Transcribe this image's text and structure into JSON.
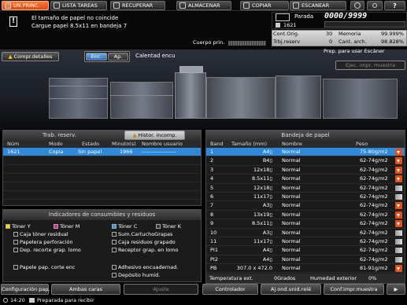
{
  "tabs": [
    {
      "label": "UN.PRINC.",
      "active": true
    },
    {
      "label": "LISTA TAREAS"
    },
    {
      "label": "RECUPERAR"
    },
    {
      "label": "ALMACENAR"
    },
    {
      "label": "COPIAR"
    },
    {
      "label": "ESCANEAR"
    }
  ],
  "message": {
    "line1": "El tamaño de papel no coincide",
    "line2": "Cargue papel 8.5x11 en bandeja 7"
  },
  "counter": {
    "state": "Parada",
    "value": "0000/9999",
    "job": "1621"
  },
  "stats": {
    "orig_label": "Cont.Orig.",
    "orig_value": "30",
    "mem_label": "Memoria",
    "mem_value": "99.999%",
    "reserv_label": "Trbj.reserv",
    "reserv_value": "0",
    "arch_label": "Cant. arch.",
    "arch_value": "98.828%"
  },
  "cuerpo_label": "Cuerpo prin.",
  "machine": {
    "details_button": "Compr.detalles",
    "enc_button": "Enc.",
    "ap_button": "Ap.",
    "heat_label": "Calentad encu",
    "scan_status": "Prep. para usar Escáner",
    "sample_button": "Ejec. impr. muestra"
  },
  "jobs": {
    "title": "Trab. reserv.",
    "history_button": "Histor. incomp.",
    "columns": [
      "Núm",
      "Modo",
      "Estado",
      "Minuto(s)",
      "Nombre usuario"
    ],
    "rows": [
      {
        "num": "1621",
        "mode": "Copia",
        "state": "Sin papel",
        "minutes": "1966",
        "user": "-------------------"
      }
    ]
  },
  "consumables": {
    "title": "Indicadores de consumibles y residuos",
    "items": [
      "Tóner Y",
      "Tóner M",
      "Tóner C",
      "Tóner K",
      "Caja tóner residual",
      "Sum.CartuchoGrapas",
      "Papelera perforación",
      "Caja residuos grapado",
      "Dep. recorte grap. lomo",
      "Receptor grap. en lomo",
      "Papele pap. corte enc",
      "Adhesivo encuadernad.",
      "Depósito humid."
    ]
  },
  "trays": {
    "title": "Bandeja de papel",
    "columns": [
      "Band",
      "Tamaño (mm)",
      "Nombre",
      "Peso"
    ],
    "rows": [
      {
        "band": "1",
        "size": "A4▯",
        "name": "Normal",
        "weight": "75-80g/m2",
        "ind": "arrow",
        "sel": true
      },
      {
        "band": "2",
        "size": "B4▯",
        "name": "Normal",
        "weight": "62-74g/m2",
        "ind": "arrow"
      },
      {
        "band": "3",
        "size": "12x18▯",
        "name": "Normal",
        "weight": "62-74g/m2",
        "ind": "arrow"
      },
      {
        "band": "4",
        "size": "8.5x11▯",
        "name": "Normal",
        "weight": "62-74g/m2",
        "ind": "arrow"
      },
      {
        "band": "5",
        "size": "12x18▯",
        "name": "Normal",
        "weight": "62-74g/m2",
        "ind": "gauge"
      },
      {
        "band": "6",
        "size": "11x17▯",
        "name": "Normal",
        "weight": "62-74g/m2",
        "ind": "gauge"
      },
      {
        "band": "7",
        "size": "A3▯",
        "name": "Normal",
        "weight": "62-74g/m2",
        "ind": "arrow"
      },
      {
        "band": "8",
        "size": "13x19▯",
        "name": "Normal",
        "weight": "62-74g/m2",
        "ind": "arrow"
      },
      {
        "band": "9",
        "size": "8.5x11▯",
        "name": "Normal",
        "weight": "62-74g/m2",
        "ind": "arrow"
      },
      {
        "band": "10",
        "size": "A3▯",
        "name": "Normal",
        "weight": "62-74g/m2",
        "ind": "gauge"
      },
      {
        "band": "11",
        "size": "11x17▯",
        "name": "Normal",
        "weight": "62-74g/m2",
        "ind": "gauge"
      },
      {
        "band": "PI1",
        "size": "A4▯",
        "name": "Normal",
        "weight": "62-74g/m2",
        "ind": "gauge"
      },
      {
        "band": "PI2",
        "size": "A4▯",
        "name": "Normal",
        "weight": "62-74g/m2",
        "ind": "gauge"
      },
      {
        "band": "PB",
        "size": "307.0 x 472.0",
        "name": "Normal",
        "weight": "81-91g/m2",
        "ind": "arrow"
      }
    ],
    "temp_label": "Temperatura ext.",
    "temp_value": "0Grados",
    "hum_label": "Humedad exterior",
    "hum_value": "0%"
  },
  "bottom": [
    "Configuración pap.",
    "Ambas caras",
    "Ajuste",
    "Controlador",
    "Aj.ond.unid.relé",
    "Conf.impr.muestra"
  ],
  "status": {
    "time": "14:20",
    "text": "Preparada para recibir"
  }
}
